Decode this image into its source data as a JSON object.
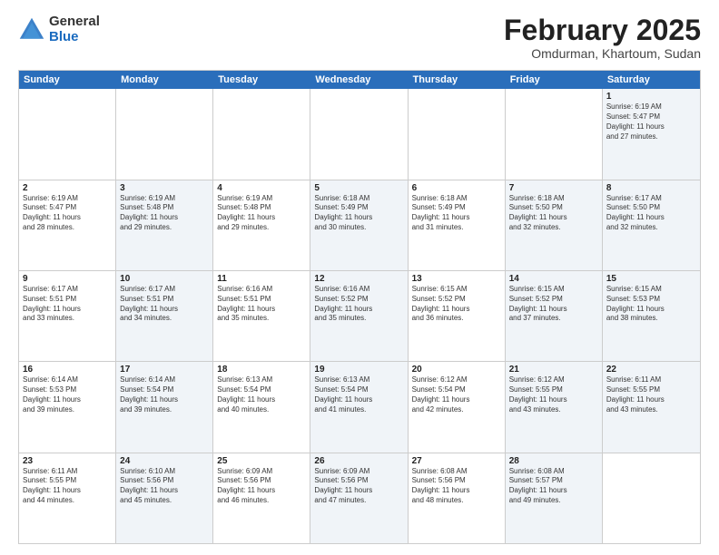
{
  "logo": {
    "general": "General",
    "blue": "Blue"
  },
  "title": "February 2025",
  "subtitle": "Omdurman, Khartoum, Sudan",
  "days": [
    "Sunday",
    "Monday",
    "Tuesday",
    "Wednesday",
    "Thursday",
    "Friday",
    "Saturday"
  ],
  "weeks": [
    [
      {
        "day": "",
        "info": ""
      },
      {
        "day": "",
        "info": ""
      },
      {
        "day": "",
        "info": ""
      },
      {
        "day": "",
        "info": ""
      },
      {
        "day": "",
        "info": ""
      },
      {
        "day": "",
        "info": ""
      },
      {
        "day": "1",
        "info": "Sunrise: 6:19 AM\nSunset: 5:47 PM\nDaylight: 11 hours\nand 27 minutes.",
        "shaded": true
      }
    ],
    [
      {
        "day": "2",
        "info": "Sunrise: 6:19 AM\nSunset: 5:47 PM\nDaylight: 11 hours\nand 28 minutes."
      },
      {
        "day": "3",
        "info": "Sunrise: 6:19 AM\nSunset: 5:48 PM\nDaylight: 11 hours\nand 29 minutes.",
        "shaded": true
      },
      {
        "day": "4",
        "info": "Sunrise: 6:19 AM\nSunset: 5:48 PM\nDaylight: 11 hours\nand 29 minutes."
      },
      {
        "day": "5",
        "info": "Sunrise: 6:18 AM\nSunset: 5:49 PM\nDaylight: 11 hours\nand 30 minutes.",
        "shaded": true
      },
      {
        "day": "6",
        "info": "Sunrise: 6:18 AM\nSunset: 5:49 PM\nDaylight: 11 hours\nand 31 minutes."
      },
      {
        "day": "7",
        "info": "Sunrise: 6:18 AM\nSunset: 5:50 PM\nDaylight: 11 hours\nand 32 minutes.",
        "shaded": true
      },
      {
        "day": "8",
        "info": "Sunrise: 6:17 AM\nSunset: 5:50 PM\nDaylight: 11 hours\nand 32 minutes.",
        "shaded": true
      }
    ],
    [
      {
        "day": "9",
        "info": "Sunrise: 6:17 AM\nSunset: 5:51 PM\nDaylight: 11 hours\nand 33 minutes."
      },
      {
        "day": "10",
        "info": "Sunrise: 6:17 AM\nSunset: 5:51 PM\nDaylight: 11 hours\nand 34 minutes.",
        "shaded": true
      },
      {
        "day": "11",
        "info": "Sunrise: 6:16 AM\nSunset: 5:51 PM\nDaylight: 11 hours\nand 35 minutes."
      },
      {
        "day": "12",
        "info": "Sunrise: 6:16 AM\nSunset: 5:52 PM\nDaylight: 11 hours\nand 35 minutes.",
        "shaded": true
      },
      {
        "day": "13",
        "info": "Sunrise: 6:15 AM\nSunset: 5:52 PM\nDaylight: 11 hours\nand 36 minutes."
      },
      {
        "day": "14",
        "info": "Sunrise: 6:15 AM\nSunset: 5:52 PM\nDaylight: 11 hours\nand 37 minutes.",
        "shaded": true
      },
      {
        "day": "15",
        "info": "Sunrise: 6:15 AM\nSunset: 5:53 PM\nDaylight: 11 hours\nand 38 minutes.",
        "shaded": true
      }
    ],
    [
      {
        "day": "16",
        "info": "Sunrise: 6:14 AM\nSunset: 5:53 PM\nDaylight: 11 hours\nand 39 minutes."
      },
      {
        "day": "17",
        "info": "Sunrise: 6:14 AM\nSunset: 5:54 PM\nDaylight: 11 hours\nand 39 minutes.",
        "shaded": true
      },
      {
        "day": "18",
        "info": "Sunrise: 6:13 AM\nSunset: 5:54 PM\nDaylight: 11 hours\nand 40 minutes."
      },
      {
        "day": "19",
        "info": "Sunrise: 6:13 AM\nSunset: 5:54 PM\nDaylight: 11 hours\nand 41 minutes.",
        "shaded": true
      },
      {
        "day": "20",
        "info": "Sunrise: 6:12 AM\nSunset: 5:54 PM\nDaylight: 11 hours\nand 42 minutes."
      },
      {
        "day": "21",
        "info": "Sunrise: 6:12 AM\nSunset: 5:55 PM\nDaylight: 11 hours\nand 43 minutes.",
        "shaded": true
      },
      {
        "day": "22",
        "info": "Sunrise: 6:11 AM\nSunset: 5:55 PM\nDaylight: 11 hours\nand 43 minutes.",
        "shaded": true
      }
    ],
    [
      {
        "day": "23",
        "info": "Sunrise: 6:11 AM\nSunset: 5:55 PM\nDaylight: 11 hours\nand 44 minutes."
      },
      {
        "day": "24",
        "info": "Sunrise: 6:10 AM\nSunset: 5:56 PM\nDaylight: 11 hours\nand 45 minutes.",
        "shaded": true
      },
      {
        "day": "25",
        "info": "Sunrise: 6:09 AM\nSunset: 5:56 PM\nDaylight: 11 hours\nand 46 minutes."
      },
      {
        "day": "26",
        "info": "Sunrise: 6:09 AM\nSunset: 5:56 PM\nDaylight: 11 hours\nand 47 minutes.",
        "shaded": true
      },
      {
        "day": "27",
        "info": "Sunrise: 6:08 AM\nSunset: 5:56 PM\nDaylight: 11 hours\nand 48 minutes."
      },
      {
        "day": "28",
        "info": "Sunrise: 6:08 AM\nSunset: 5:57 PM\nDaylight: 11 hours\nand 49 minutes.",
        "shaded": true
      },
      {
        "day": "",
        "info": ""
      }
    ]
  ]
}
